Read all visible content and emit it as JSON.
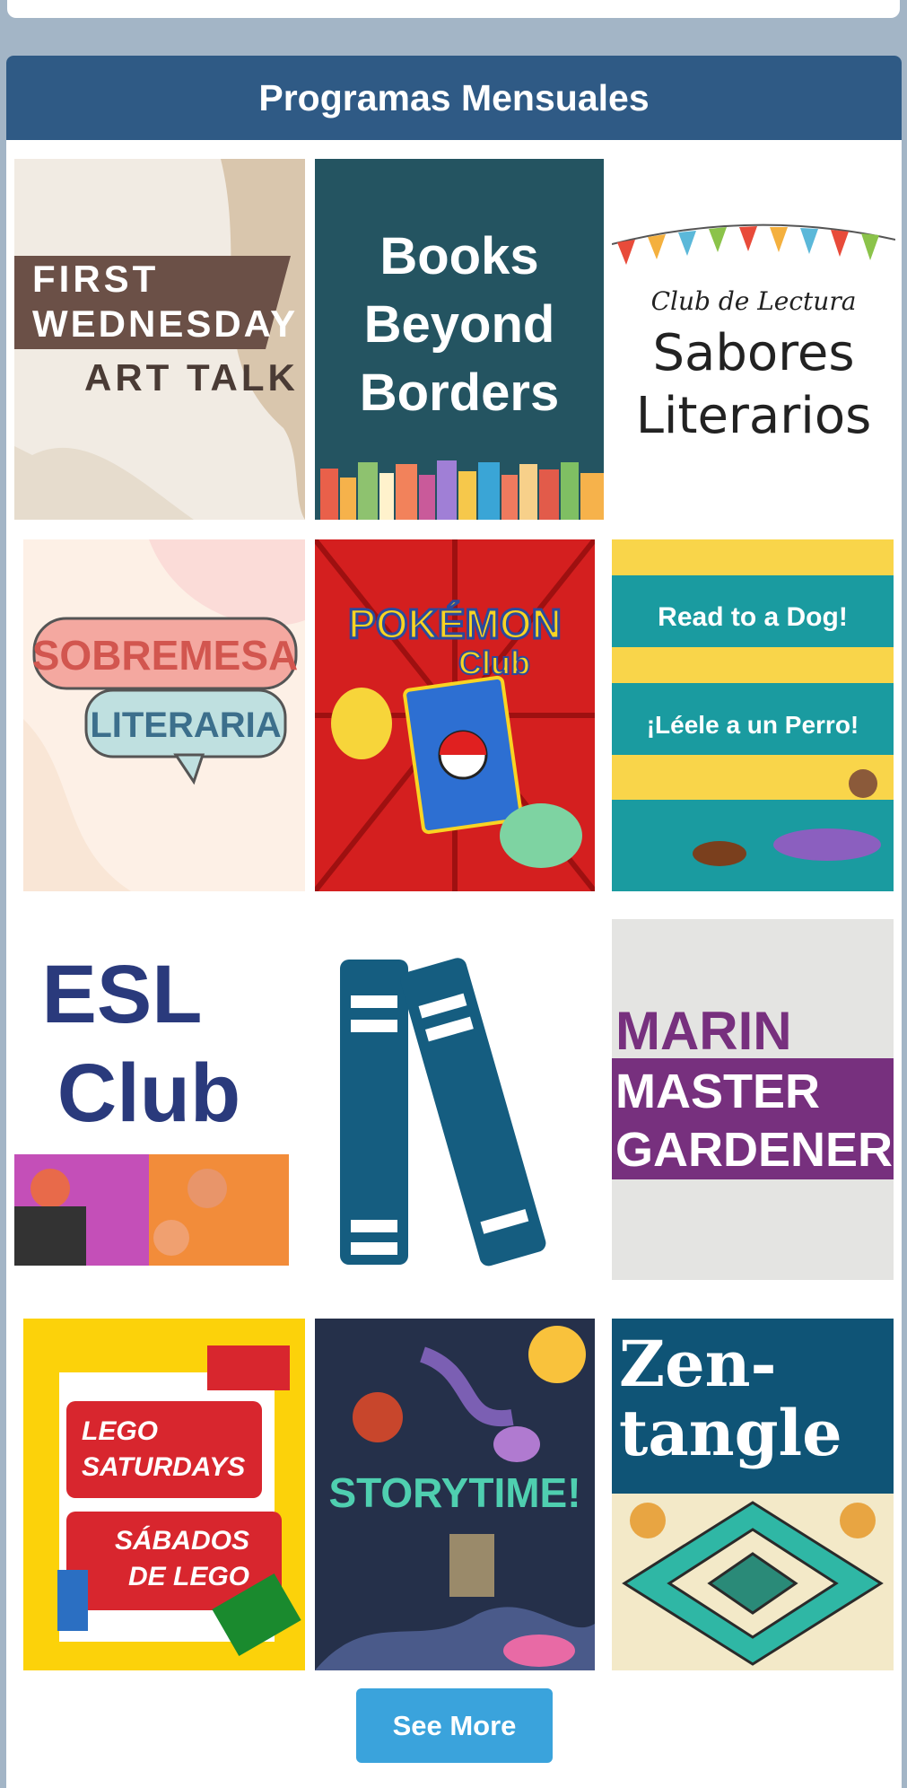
{
  "section": {
    "title": "Programas Mensuales",
    "see_more_label": "See More"
  },
  "programs": [
    {
      "id": "first-wednesday",
      "lines": [
        "FIRST",
        "WEDNESDAY",
        "ART TALK"
      ]
    },
    {
      "id": "books-beyond-borders",
      "lines": [
        "Books",
        "Beyond",
        "Borders"
      ]
    },
    {
      "id": "sabores-literarios",
      "lines": [
        "Club de Lectura",
        "Sabores",
        "Literarios"
      ]
    },
    {
      "id": "sobremesa-literaria",
      "lines": [
        "SOBREMESA",
        "LITERARIA"
      ]
    },
    {
      "id": "pokemon-club",
      "lines": [
        "POKÉMON",
        "Club"
      ]
    },
    {
      "id": "read-to-a-dog",
      "lines": [
        "Read to a Dog!",
        "¡Léele a un Perro!"
      ]
    },
    {
      "id": "esl-club",
      "lines": [
        "ESL",
        "Club"
      ]
    },
    {
      "id": "books-icon"
    },
    {
      "id": "marin-master-gardeners",
      "lines": [
        "MARIN",
        "MASTER",
        "GARDENERS"
      ]
    },
    {
      "id": "lego-saturdays",
      "lines": [
        "LEGO",
        "SATURDAYS",
        "SÁBADOS",
        "DE LEGO"
      ]
    },
    {
      "id": "storytime",
      "lines": [
        "STORYTIME!"
      ]
    },
    {
      "id": "zentangle",
      "lines": [
        "Zen-",
        "tangle"
      ]
    }
  ],
  "colors": {
    "header": "#2f5a85",
    "button": "#3aa3dc",
    "page_bg": "#a3b5c6"
  }
}
